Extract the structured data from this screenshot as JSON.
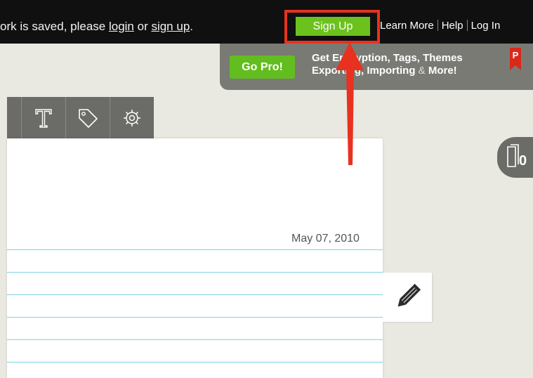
{
  "topbar": {
    "message_prefix": "ork is saved, please ",
    "login_link": "login",
    "message_middle": " or ",
    "signup_link": "sign up",
    "message_suffix": ".",
    "signup_button": "Sign Up",
    "links": [
      "Learn More",
      "Help",
      "Log In"
    ]
  },
  "pro_banner": {
    "button": "Go Pro!",
    "line1": "Get Encryption, Tags, Themes",
    "line2_a": "Exporting, Importing",
    "line2_amp": " & ",
    "line2_b": "More!",
    "flag_letter": "P"
  },
  "toolbar": {
    "icons": [
      "typography-icon",
      "tag-icon",
      "gear-icon"
    ]
  },
  "note": {
    "date": "May 07, 2010"
  },
  "counter": {
    "value": "0"
  },
  "colors": {
    "signup_green": "#6cc21c",
    "annotation_red": "#e8321f",
    "rule_line": "#7fd3e0"
  }
}
